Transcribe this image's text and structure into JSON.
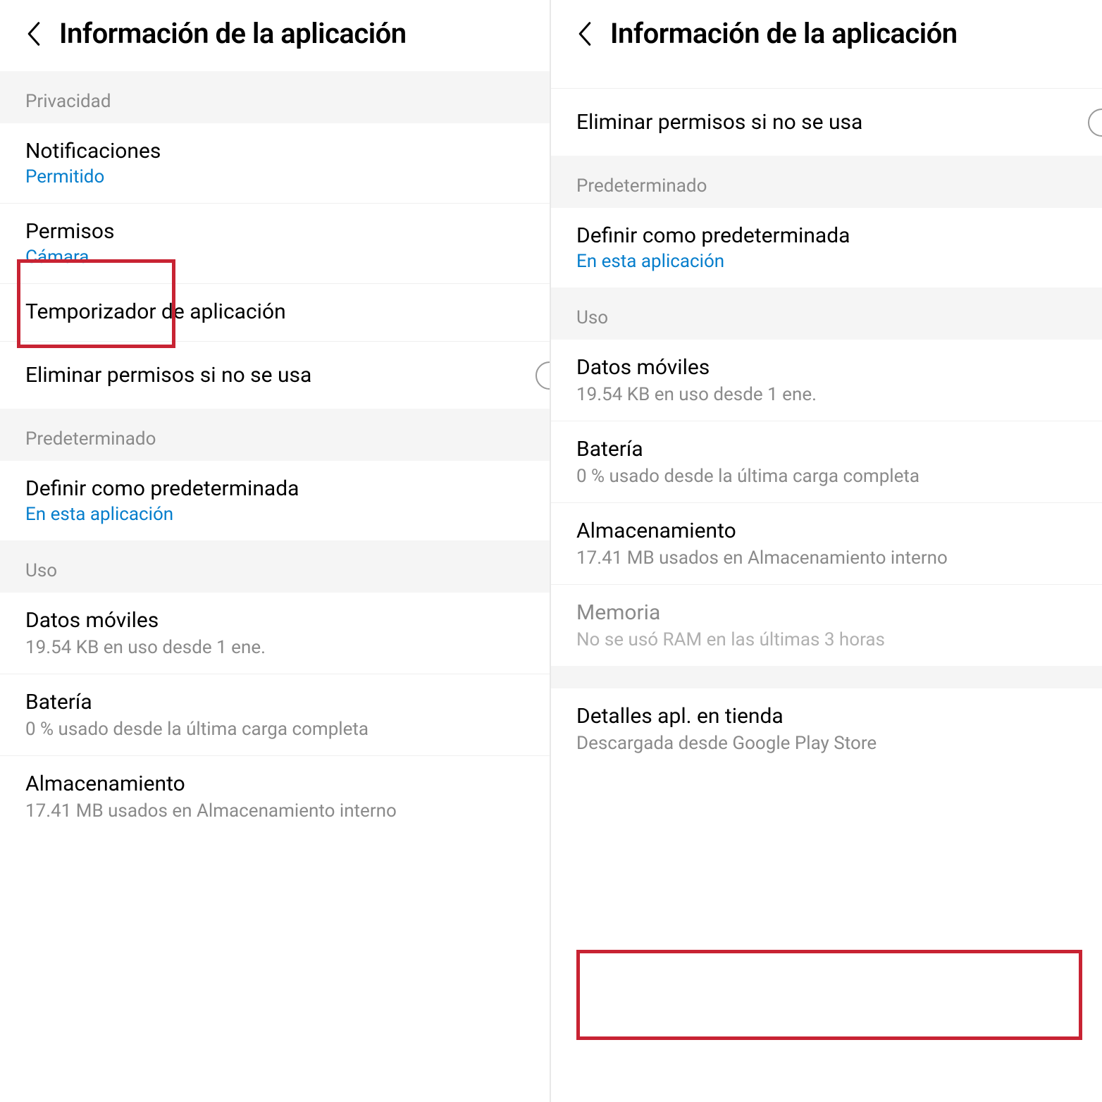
{
  "left": {
    "header_title": "Información de la aplicación",
    "section_privacy": "Privacidad",
    "notifications": {
      "title": "Notificaciones",
      "sub": "Permitido"
    },
    "permissions": {
      "title": "Permisos",
      "sub": "Cámara"
    },
    "timer": {
      "title": "Temporizador de aplicación"
    },
    "remove_perms": {
      "title": "Eliminar permisos si no se usa"
    },
    "section_default": "Predeterminado",
    "set_default": {
      "title": "Definir como predeterminada",
      "sub": "En esta aplicación"
    },
    "section_usage": "Uso",
    "mobile_data": {
      "title": "Datos móviles",
      "sub": "19.54 KB en uso desde 1 ene."
    },
    "battery": {
      "title": "Batería",
      "sub": "0 % usado desde la última carga completa"
    },
    "storage": {
      "title": "Almacenamiento",
      "sub": "17.41 MB usados en Almacenamiento interno"
    }
  },
  "right": {
    "header_title": "Información de la aplicación",
    "remove_perms": {
      "title": "Eliminar permisos si no se usa"
    },
    "section_default": "Predeterminado",
    "set_default": {
      "title": "Definir como predeterminada",
      "sub": "En esta aplicación"
    },
    "section_usage": "Uso",
    "mobile_data": {
      "title": "Datos móviles",
      "sub": "19.54 KB en uso desde 1 ene."
    },
    "battery": {
      "title": "Batería",
      "sub": "0 % usado desde la última carga completa"
    },
    "storage": {
      "title": "Almacenamiento",
      "sub": "17.41 MB usados en Almacenamiento interno"
    },
    "memory": {
      "title": "Memoria",
      "sub": "No se usó RAM en las últimas 3 horas"
    },
    "store_details": {
      "title": "Detalles apl. en tienda",
      "sub": "Descargada desde Google Play Store"
    }
  }
}
